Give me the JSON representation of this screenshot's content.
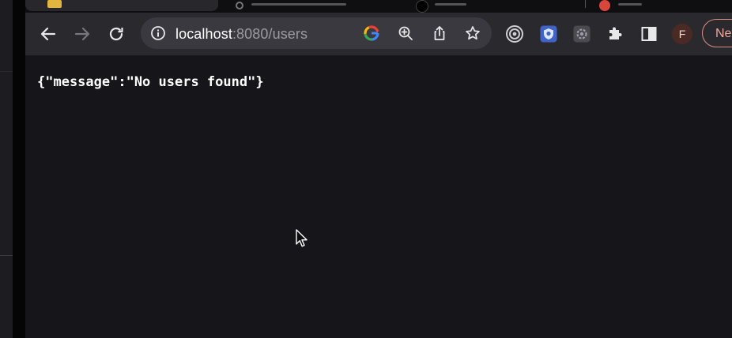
{
  "address_bar": {
    "host": "localhost",
    "rest": ":8080/users"
  },
  "profile": {
    "initial": "F"
  },
  "new_button": {
    "label": "Ne"
  },
  "page": {
    "json_text": "{\"message\":\"No users found\"}"
  },
  "colors": {
    "toolbar": "#2a292e",
    "omnibox": "#3a393f",
    "page_background": "#151417",
    "new_button_border": "#d98c82"
  },
  "icons": {
    "back": "arrow-left",
    "forward": "arrow-right",
    "reload": "reload",
    "info": "info-circle",
    "google": "google-g",
    "zoom": "zoom-in",
    "share": "share",
    "bookmark": "star",
    "extensions": [
      "target-extension",
      "shield-extension",
      "gear-extension",
      "puzzle-extensions"
    ],
    "side_panel": "side-panel"
  }
}
